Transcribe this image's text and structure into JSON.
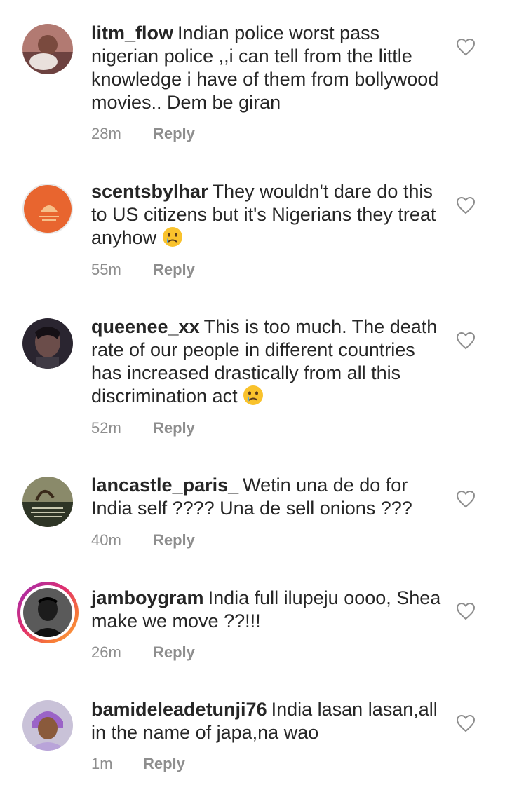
{
  "comments": [
    {
      "username": "litm_flow",
      "text": "Indian police worst pass nigerian police ,,i can tell from the little knowledge i have of them from bollywood movies.. Dem be giran",
      "time": "28m",
      "reply": "Reply",
      "emoji": ""
    },
    {
      "username": "scentsbylhar",
      "text": "They wouldn't dare do this to US citizens but it's Nigerians they treat anyhow",
      "time": "55m",
      "reply": "Reply",
      "emoji": "crying-face-emoji"
    },
    {
      "username": "queenee_xx",
      "text": "This is too much. The death rate of our people in different countries has increased drastically from all this discrimination act",
      "time": "52m",
      "reply": "Reply",
      "emoji": "crying-face-emoji"
    },
    {
      "username": "lancastle_paris_",
      "text": "Wetin una de do for India self ???? Una de sell onions ???",
      "time": "40m",
      "reply": "Reply",
      "emoji": ""
    },
    {
      "username": "jamboygram",
      "text": "India full ilupeju oooo, Shea make we move ??!!!",
      "time": "26m",
      "reply": "Reply",
      "emoji": ""
    },
    {
      "username": "bamideleadetunji76",
      "text": "India lasan lasan,all in the name of japa,na wao",
      "time": "1m",
      "reply": "Reply",
      "emoji": ""
    }
  ],
  "colors": {
    "text": "#262626",
    "meta": "#8e8e8e",
    "story_ring": "#e1306c"
  },
  "icons": {
    "like": "heart-outline-icon"
  }
}
